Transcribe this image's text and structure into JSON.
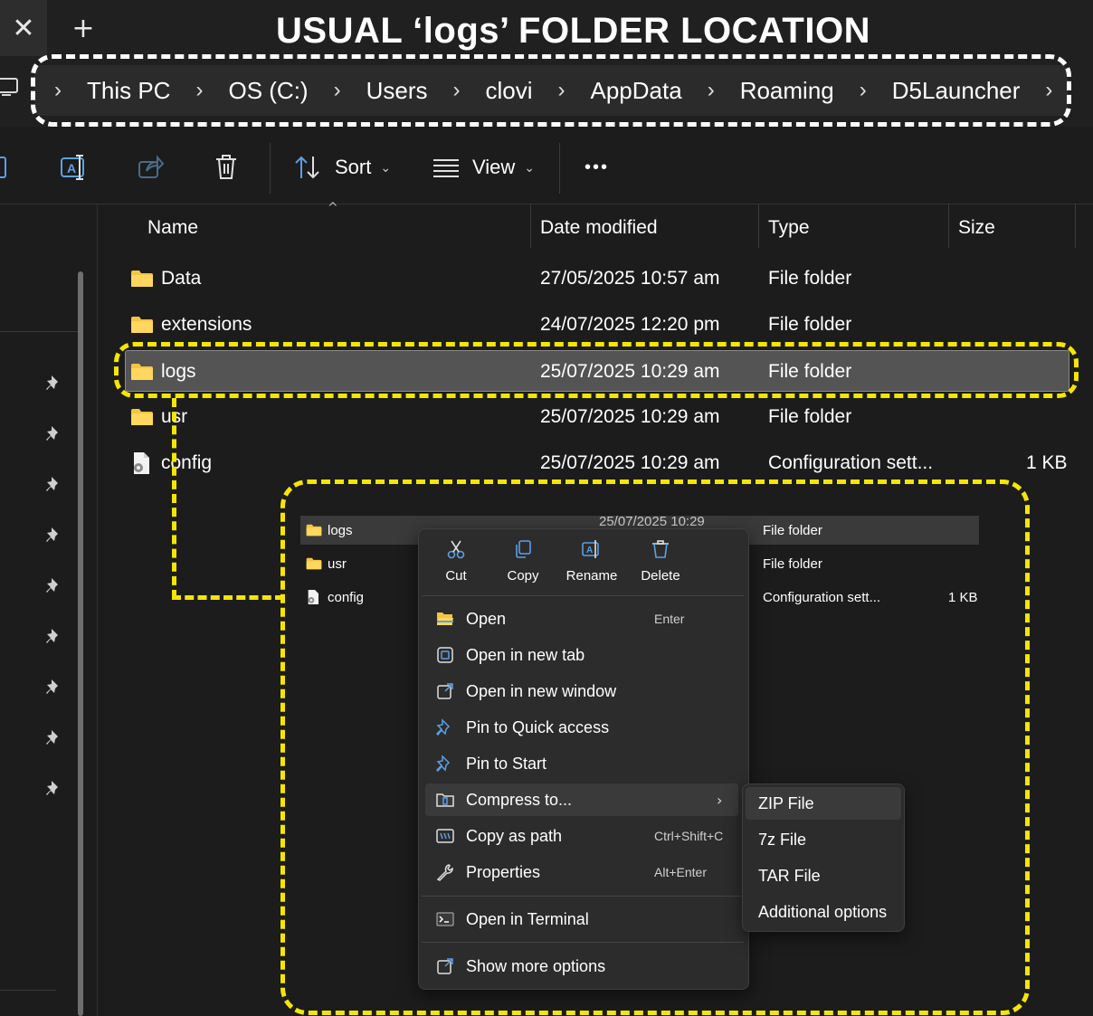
{
  "window": {
    "close_glyph": "✕",
    "new_tab_glyph": "+"
  },
  "annotation": {
    "title": "USUAL ‘logs’ FOLDER LOCATION",
    "address_outline_color": "#ffffff",
    "highlight_color": "#f5e600"
  },
  "address_bar": {
    "separator": "›",
    "crumbs": [
      "This PC",
      "OS (C:)",
      "Users",
      "clovi",
      "AppData",
      "Roaming",
      "D5Launcher"
    ]
  },
  "toolbar": {
    "sort_label": "Sort",
    "view_label": "View",
    "more_glyph": "•••",
    "caret": "⌄"
  },
  "file_list": {
    "sort_indicator": "^",
    "columns": [
      "Name",
      "Date modified",
      "Type",
      "Size"
    ],
    "rows": [
      {
        "name": "Data",
        "date": "27/05/2025 10:57 am",
        "type": "File folder",
        "size": "",
        "icon": "folder-icon"
      },
      {
        "name": "extensions",
        "date": "24/07/2025 12:20 pm",
        "type": "File folder",
        "size": "",
        "icon": "folder-icon"
      },
      {
        "name": "logs",
        "date": "25/07/2025 10:29 am",
        "type": "File folder",
        "size": "",
        "icon": "folder-icon",
        "selected": true
      },
      {
        "name": "usr",
        "date": "25/07/2025 10:29 am",
        "type": "File folder",
        "size": "",
        "icon": "folder-icon"
      },
      {
        "name": "config",
        "date": "25/07/2025 10:29 am",
        "type": "Configuration sett...",
        "size": "1 KB",
        "icon": "config-file-icon"
      }
    ]
  },
  "inset": {
    "rows": [
      {
        "name": "logs",
        "date": "25/07/2025 10:29",
        "type": "File folder",
        "size": ""
      },
      {
        "name": "usr",
        "type": "File folder",
        "size": ""
      },
      {
        "name": "config",
        "type": "Configuration sett...",
        "size": "1 KB"
      }
    ]
  },
  "context_menu": {
    "quick_actions": [
      "Cut",
      "Copy",
      "Rename",
      "Delete"
    ],
    "items": [
      {
        "label": "Open",
        "shortcut": "Enter"
      },
      {
        "label": "Open in new tab",
        "shortcut": ""
      },
      {
        "label": "Open in new window",
        "shortcut": ""
      },
      {
        "label": "Pin to Quick access",
        "shortcut": ""
      },
      {
        "label": "Pin to Start",
        "shortcut": ""
      },
      {
        "label": "Compress to...",
        "shortcut": "",
        "submenu_arrow": "›"
      },
      {
        "label": "Copy as path",
        "shortcut": "Ctrl+Shift+C"
      },
      {
        "label": "Properties",
        "shortcut": "Alt+Enter"
      },
      {
        "label": "Open in Terminal",
        "shortcut": ""
      },
      {
        "label": "Show more options",
        "shortcut": ""
      }
    ]
  },
  "compress_submenu": {
    "items": [
      "ZIP File",
      "7z File",
      "TAR File",
      "Additional options"
    ]
  }
}
